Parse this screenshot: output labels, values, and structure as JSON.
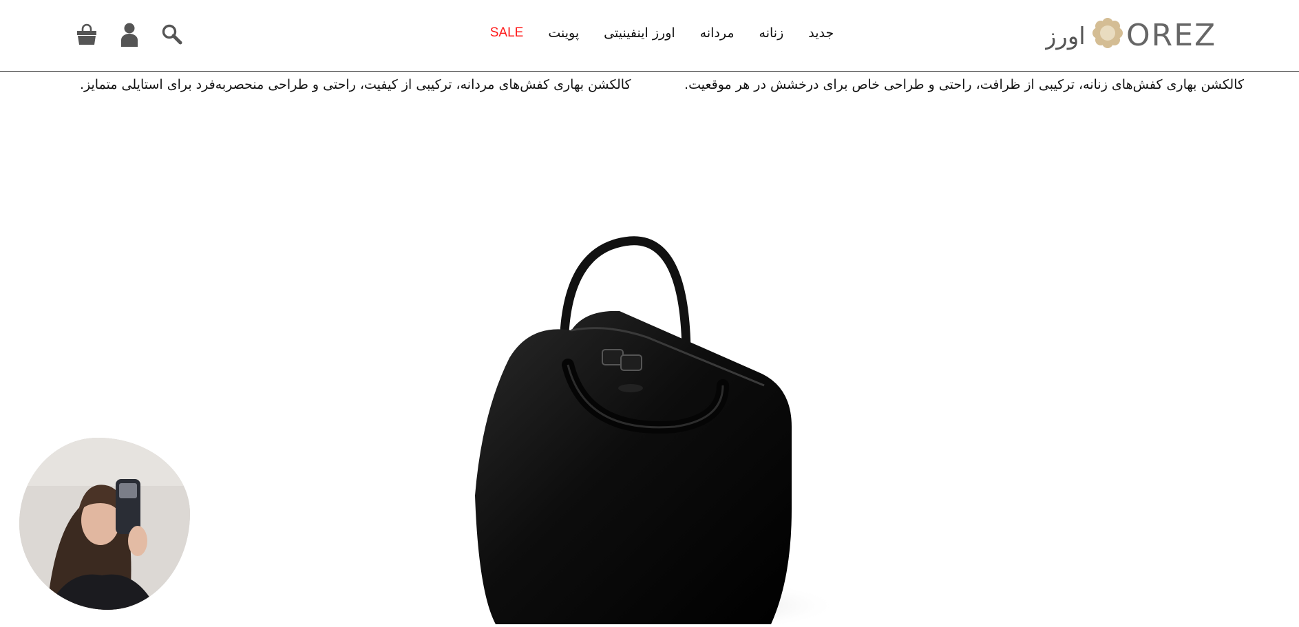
{
  "brand": {
    "logo_latin": "OREZ",
    "logo_persian": "اورز",
    "accent_color": "#d4bd94",
    "sale_color": "#ff1a1a"
  },
  "header": {
    "icons": [
      "shopping-bag-icon",
      "user-icon",
      "search-icon"
    ],
    "nav": [
      {
        "label": "جدید"
      },
      {
        "label": "زنانه"
      },
      {
        "label": "مردانه"
      },
      {
        "label": "اورز اینفینیتی"
      },
      {
        "label": "پوینت"
      },
      {
        "label": "SALE"
      }
    ]
  },
  "promos": {
    "women": "کالکشن بهاری کفش‌های زنانه، ترکیبی از ظرافت، راحتی و طراحی خاص برای درخشش در هر موقعیت.",
    "men": "کالکشن بهاری کفش‌های مردانه، ترکیبی از کیفیت، راحتی و طراحی منحصربه‌فرد برای استایلی متمایز."
  }
}
